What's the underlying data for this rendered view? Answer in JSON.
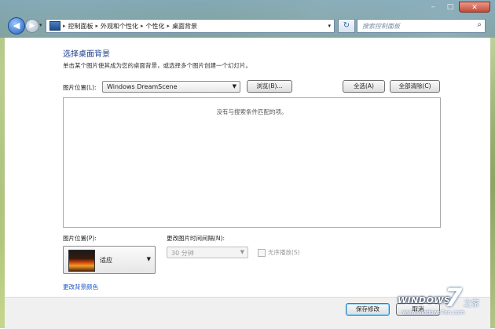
{
  "address": {
    "crumbs": [
      "控制面板",
      "外观和个性化",
      "个性化",
      "桌面背景"
    ],
    "search_placeholder": "搜索控制面板"
  },
  "page": {
    "heading": "选择桌面背景",
    "description": "单击某个图片使其成为您的桌面背景，或选择多个图片创建一个幻灯片。",
    "location_label": "图片位置(L):",
    "location_value": "Windows DreamScene",
    "browse_label": "浏览(B)...",
    "select_all_label": "全选(A)",
    "clear_all_label": "全部清除(C)",
    "empty_message": "没有与搜索条件匹配的项。",
    "position_label": "图片位置(P):",
    "position_value": "适应",
    "interval_label": "更改图片时间间隔(N):",
    "interval_value": "30 分钟",
    "shuffle_label": "无序播放(S)",
    "change_color_link": "更改背景颜色"
  },
  "footer": {
    "save_label": "保存修改",
    "cancel_label": "取消"
  },
  "watermark": {
    "brand": "WINDOWS",
    "seven": "7",
    "suffix": "之家",
    "url": "www.windows7en.com"
  }
}
